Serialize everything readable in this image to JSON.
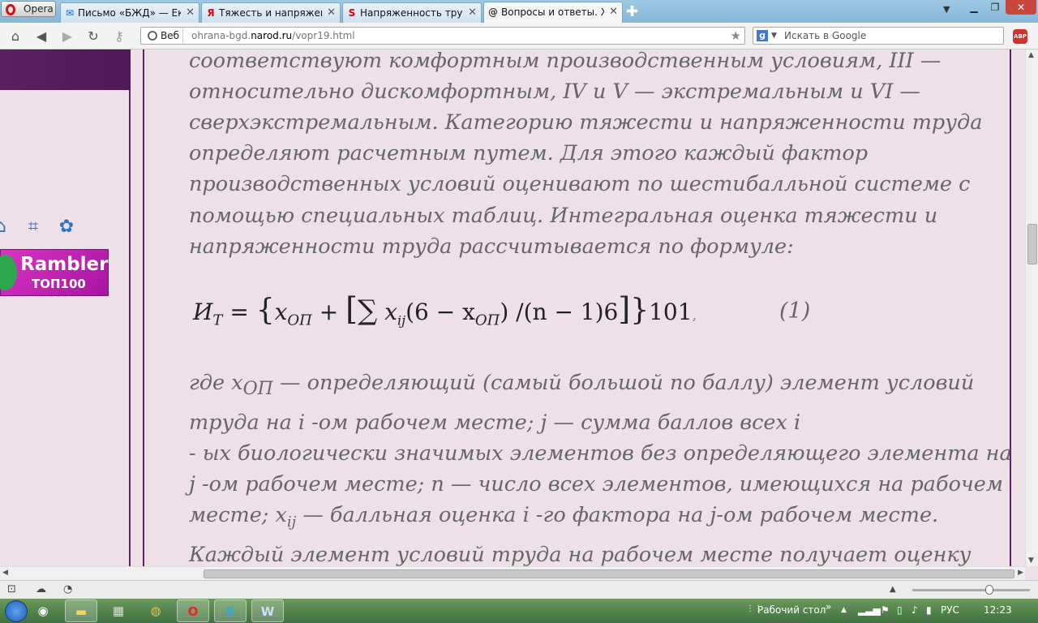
{
  "browser": {
    "menu_label": "Opera",
    "tabs": [
      {
        "label": "Письмо «БЖД» — Ека...",
        "icon": "mail-icon"
      },
      {
        "label": "Тяжесть и напряженн...",
        "icon": "yandex-icon"
      },
      {
        "label": "Напряженность труда...",
        "icon": "s-site-icon"
      },
      {
        "label": "Вопросы и ответы. Ха...",
        "icon": "narod-icon"
      }
    ],
    "address": {
      "scheme_label": "Веб",
      "url_prefix": "ohrana-bgd.",
      "url_domain": "narod.ru",
      "url_path": "/vopr19.html"
    },
    "search_placeholder": "Искать в Google",
    "search_engine_letter": "g",
    "adblock_label": "ABP"
  },
  "sidebar": {
    "rambler_line1": "Rambler",
    "rambler_line2": "ТОП100"
  },
  "content": {
    "lines_top": [
      "соответствуют комфортным производственным условиям, III —",
      "относительно дискомфортным, IV и V — экстремальным и VI —",
      "сверхэкстремальным. Категорию тяжести и напряженности труда",
      "определяют расчетным путем. Для этого каждый фактор",
      "производственных условий оценивают по шестибалльной  системе с",
      "помощью специальных таблиц. Интегральная оценка тяжести и",
      "напряженности труда рассчитывается по формуле:"
    ],
    "formula": {
      "lhs": "И",
      "lhs_sub": "Т",
      "eq": "=",
      "x": "x",
      "sub_op": "ОП",
      "plus": "+",
      "sum": "∑",
      "sub_ij": "ij",
      "mid": "(6 − x",
      "tail": ") /(n − 1)6",
      "end": "101",
      "comma": ",",
      "number": "(1)"
    },
    "where_lead": "где x",
    "where_sub": "ОП",
    "where_rest": " — определяющий (самый большой по баллу) элемент условий",
    "line_a": "труда на i -ом рабочем месте; j — сумма баллов всех i",
    "line_b": "- ых биологически значимых элементов без определяющего элемента на",
    "line_c": "j -ом рабочем месте; n — число всех элементов, имеющихся на рабочем",
    "line_d_lead": "месте; x",
    "line_d_sub": "ij",
    "line_d_rest": " — балльная оценка i -го фактора на  j-ом рабочем месте.",
    "line_e": "Каждый элемент условий труда на рабочем месте получает оценку"
  },
  "taskbar": {
    "desktop_label": "Рабочий стол",
    "lang": "РУС",
    "time": "12:23"
  }
}
